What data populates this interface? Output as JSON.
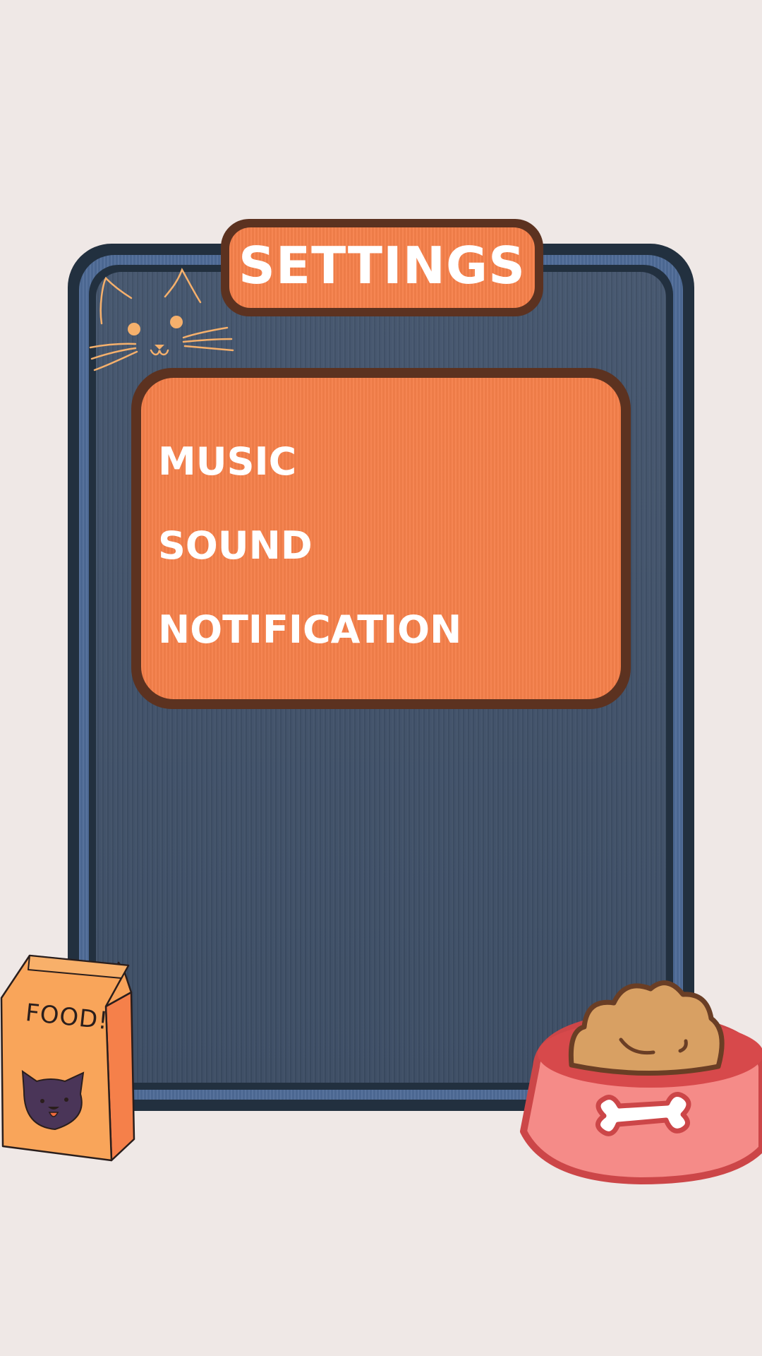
{
  "screen": {
    "title": "SETTINGS"
  },
  "menu": {
    "items": [
      {
        "label": "MUSIC"
      },
      {
        "label": "SOUND"
      },
      {
        "label": "NOTIFICATION"
      }
    ]
  },
  "decorations": {
    "food_bag_label": "FOOD!",
    "icons": [
      "cat-face-icon",
      "food-bag-icon",
      "pet-bowl-icon",
      "bone-icon"
    ]
  },
  "colors": {
    "background": "#efe8e6",
    "board": "#3c4d64",
    "board_border": "#22303f",
    "board_accent": "#4e6b97",
    "panel": "#f5804a",
    "panel_border": "#5c3220",
    "text": "#ffffff"
  }
}
